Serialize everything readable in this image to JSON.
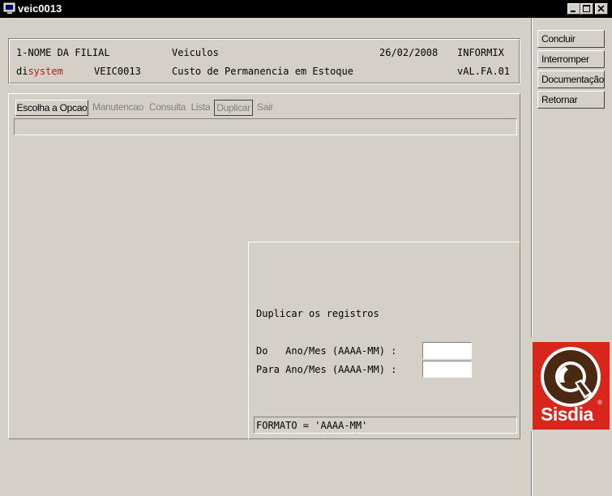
{
  "window": {
    "title": "veic0013",
    "controls": {
      "minimize_icon": "minimize-icon",
      "maximize_icon": "maximize-icon",
      "close_icon": "close-icon"
    }
  },
  "header": {
    "filial": "1-NOME DA FILIAL",
    "modulo": "Veiculos",
    "data": "26/02/2008",
    "banco": "INFORMIX",
    "logo_prefix": "di",
    "logo_brand": "system",
    "programa": "VEIC0013",
    "descricao": "Custo de Permanencia em Estoque",
    "versao": "vAL.FA.01"
  },
  "toolbar": {
    "items": [
      {
        "label": "Escolha a Opcao",
        "enabled": true
      },
      {
        "label": "Manutencao",
        "enabled": false
      },
      {
        "label": "Consulta",
        "enabled": false
      },
      {
        "label": "Lista",
        "enabled": false
      },
      {
        "label": "Duplicar",
        "enabled": false
      },
      {
        "label": "Sair",
        "enabled": false
      }
    ]
  },
  "side_buttons": {
    "concluir": "Concluir",
    "interromper": "Interromper",
    "documentacao": "Documentação",
    "retornar": "Retornar"
  },
  "form": {
    "title": "Duplicar os registros",
    "do_label": "Do   Ano/Mes (AAAA-MM) :",
    "do_value": "",
    "para_label": "Para Ano/Mes (AAAA-MM) :",
    "para_value": "",
    "hint": "FORMATO = 'AAAA-MM'"
  },
  "logo": {
    "text": "Sisdia",
    "registered": "®",
    "colors": {
      "red": "#d9261c",
      "brown": "#4a2812",
      "white": "#ffffff"
    }
  },
  "colors": {
    "titlebar": "#000000",
    "face": "#d4d0c8",
    "brand_red": "#c8141e"
  }
}
